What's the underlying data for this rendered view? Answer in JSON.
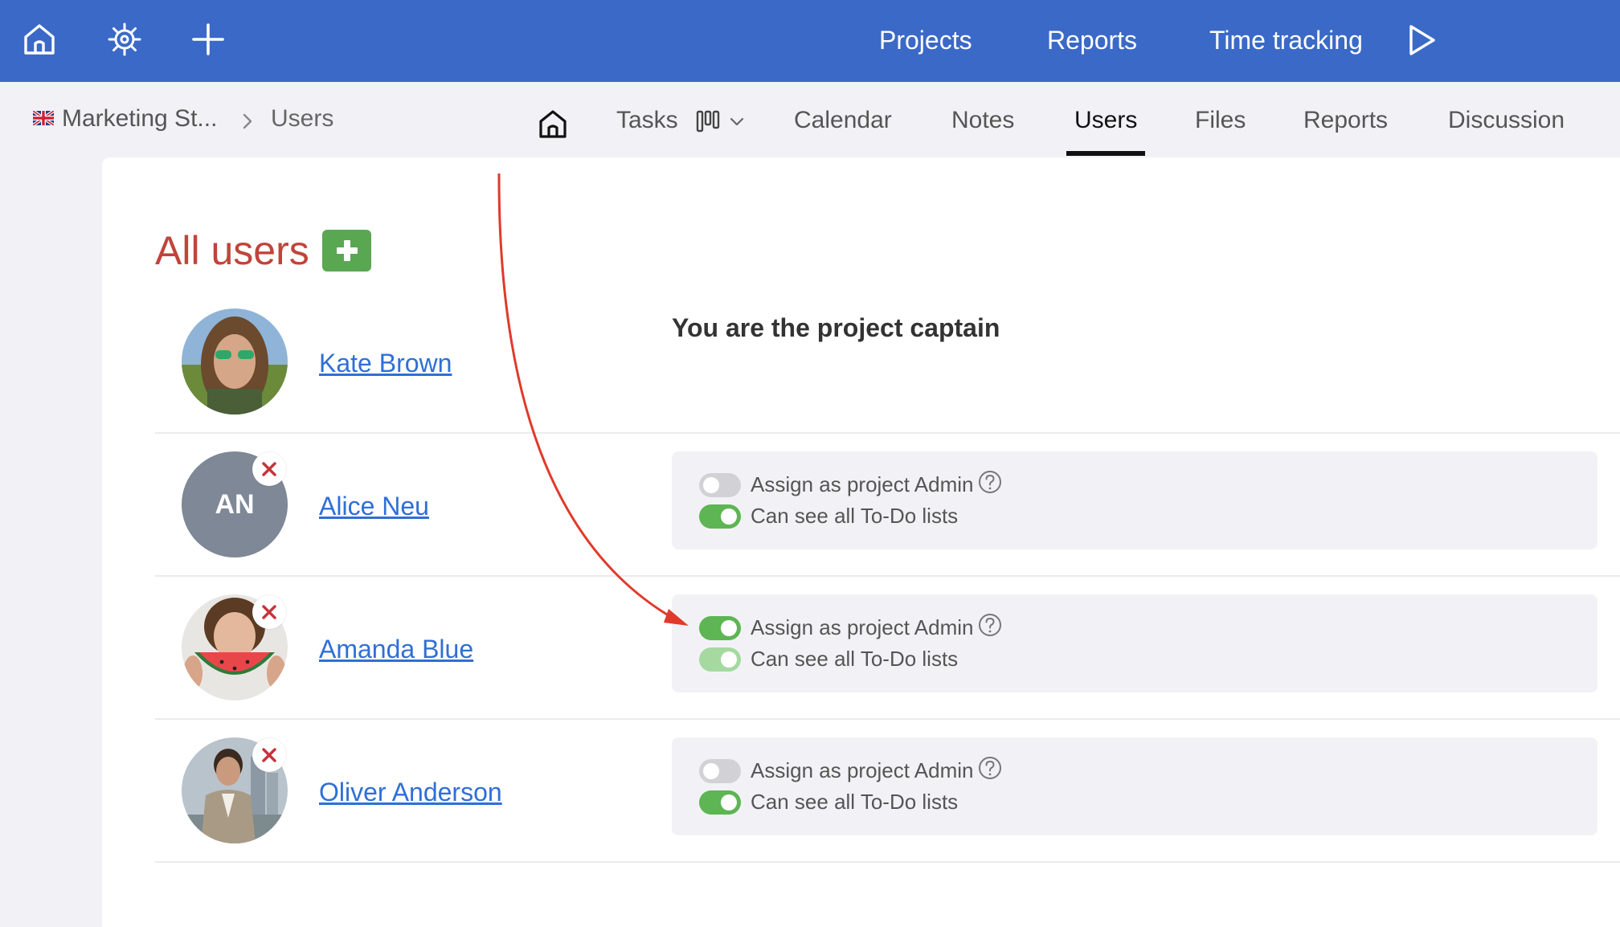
{
  "topbar": {
    "nav": {
      "projects": "Projects",
      "reports": "Reports",
      "time_tracking": "Time tracking"
    },
    "icons": [
      "home-icon",
      "helm-icon",
      "plus-icon",
      "play-icon"
    ],
    "color": "#3b69c7"
  },
  "breadcrumb": {
    "project": "Marketing St...",
    "current": "Users",
    "flag": "uk-flag-icon"
  },
  "tabs": {
    "tasks": "Tasks",
    "calendar": "Calendar",
    "notes": "Notes",
    "users": "Users",
    "files": "Files",
    "reports": "Reports",
    "discussion": "Discussion",
    "active": "Users"
  },
  "page": {
    "title": "All users",
    "title_color": "#c0443b",
    "add_button_color": "#5aa752"
  },
  "users": [
    {
      "name": "Kate Brown",
      "note": "You are the project captain"
    },
    {
      "name": "Alice Neu",
      "initials": "AN",
      "permissions": [
        {
          "label": "Assign as project Admin",
          "state": "off"
        },
        {
          "label": "Can see all To-Do lists",
          "state": "on"
        }
      ]
    },
    {
      "name": "Amanda Blue",
      "permissions": [
        {
          "label": "Assign as project Admin",
          "state": "on"
        },
        {
          "label": "Can see all To-Do lists",
          "state": "on-disabled"
        }
      ]
    },
    {
      "name": "Oliver Anderson",
      "permissions": [
        {
          "label": "Assign as project Admin",
          "state": "off"
        },
        {
          "label": "Can see all To-Do lists",
          "state": "on"
        }
      ]
    }
  ],
  "colors": {
    "toggle_on": "#5db553",
    "toggle_off": "#d2d2d6",
    "link": "#2f6fd6",
    "annotation_arrow": "#e03a2a"
  }
}
